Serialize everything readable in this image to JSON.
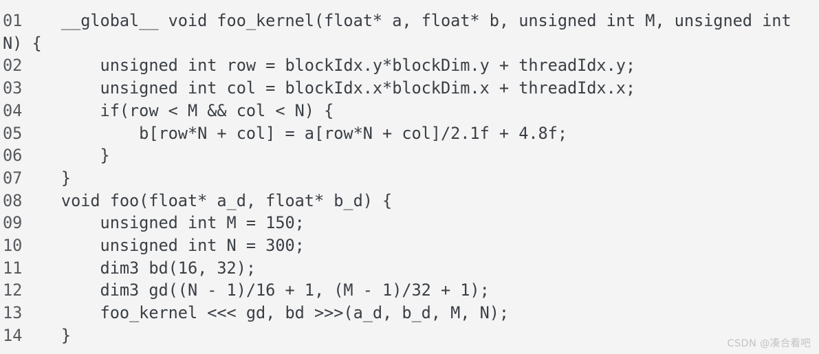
{
  "editor": {
    "background_color": "#f4f4f4",
    "text_color": "#3a3f45",
    "gutter_color": "#56595e",
    "language": "cuda-c",
    "total_lines": 14,
    "lines": [
      {
        "number": "01",
        "text": "    __global__ void foo_kernel(float* a, float* b, unsigned int M, unsigned int N) {"
      },
      {
        "number": "02",
        "text": "        unsigned int row = blockIdx.y*blockDim.y + threadIdx.y;"
      },
      {
        "number": "03",
        "text": "        unsigned int col = blockIdx.x*blockDim.x + threadIdx.x;"
      },
      {
        "number": "04",
        "text": "        if(row < M && col < N) {"
      },
      {
        "number": "05",
        "text": "            b[row*N + col] = a[row*N + col]/2.1f + 4.8f;"
      },
      {
        "number": "06",
        "text": "        }"
      },
      {
        "number": "07",
        "text": "    }"
      },
      {
        "number": "08",
        "text": "    void foo(float* a_d, float* b_d) {"
      },
      {
        "number": "09",
        "text": "        unsigned int M = 150;"
      },
      {
        "number": "10",
        "text": "        unsigned int N = 300;"
      },
      {
        "number": "11",
        "text": "        dim3 bd(16, 32);"
      },
      {
        "number": "12",
        "text": "        dim3 gd((N - 1)/16 + 1, (M - 1)/32 + 1);"
      },
      {
        "number": "13",
        "text": "        foo_kernel <<< gd, bd >>>(a_d, b_d, M, N);"
      },
      {
        "number": "14",
        "text": "    }"
      }
    ]
  },
  "watermark": {
    "text": "CSDN @凑合看吧",
    "color": "#c2c2c2"
  }
}
